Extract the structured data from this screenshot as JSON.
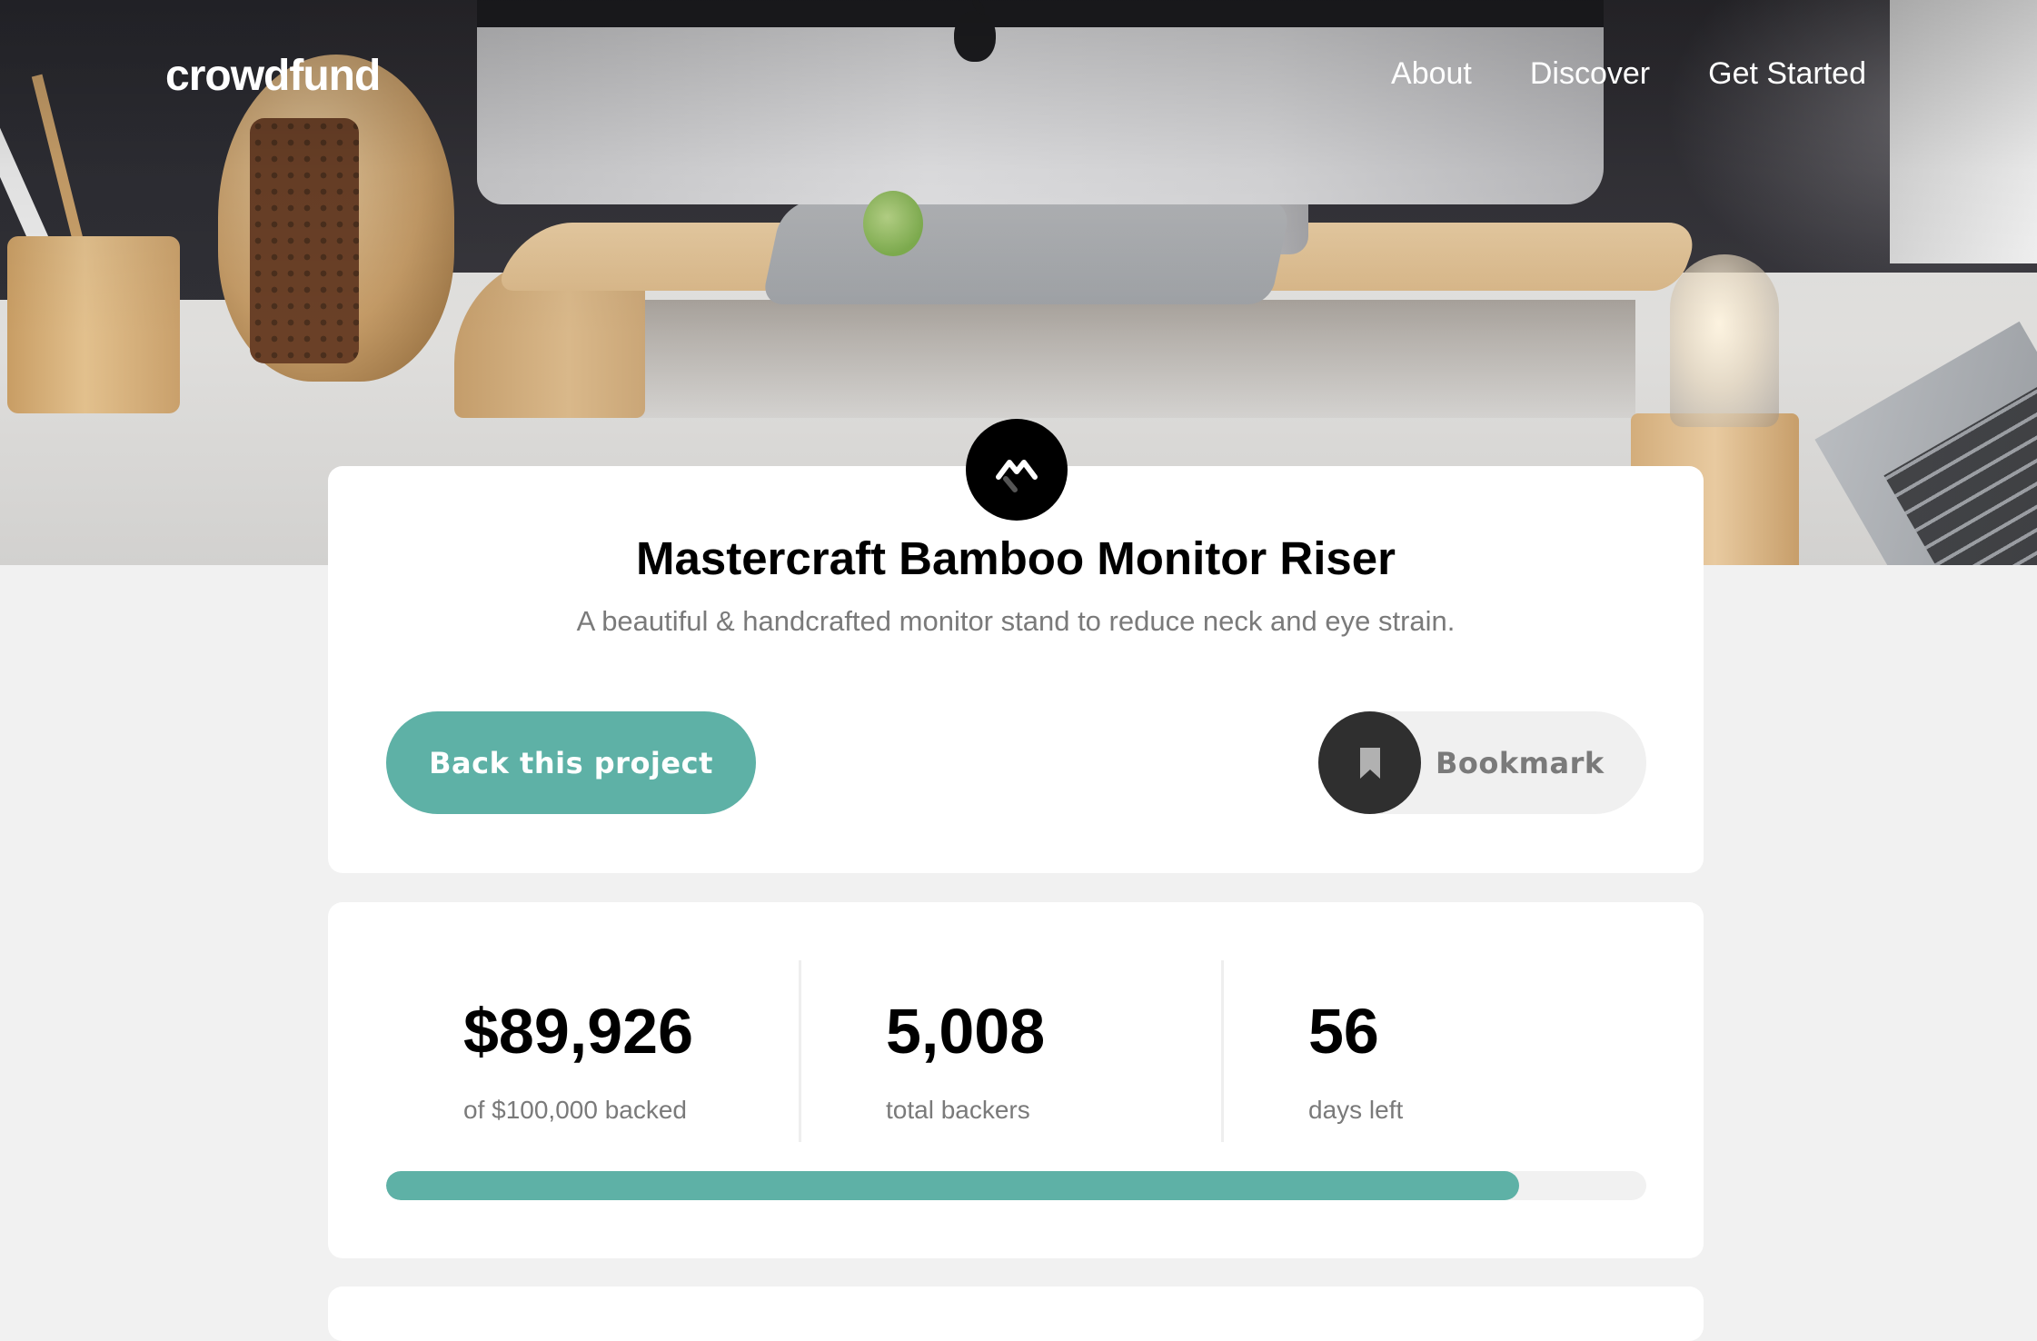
{
  "header": {
    "logo": "crowdfund",
    "nav": [
      {
        "label": "About"
      },
      {
        "label": "Discover"
      },
      {
        "label": "Get Started"
      }
    ]
  },
  "project": {
    "title": "Mastercraft Bamboo Monitor Riser",
    "subtitle": "A beautiful & handcrafted monitor stand to reduce neck and eye strain.",
    "back_label": "Back this project",
    "bookmark_label": "Bookmark",
    "logo_icon": "mastercraft-logo-icon",
    "bookmark_icon": "bookmark-icon"
  },
  "stats": {
    "backed_amount": "$89,926",
    "backed_label": "of $100,000 backed",
    "backers": "5,008",
    "backers_label": "total backers",
    "days": "56",
    "days_label": "days left",
    "progress_fraction": 0.899
  },
  "colors": {
    "accent": "#5eb1a6",
    "dark": "#2f2f2f",
    "gray_text": "#7a7a7a",
    "background": "#f1f1f1"
  }
}
